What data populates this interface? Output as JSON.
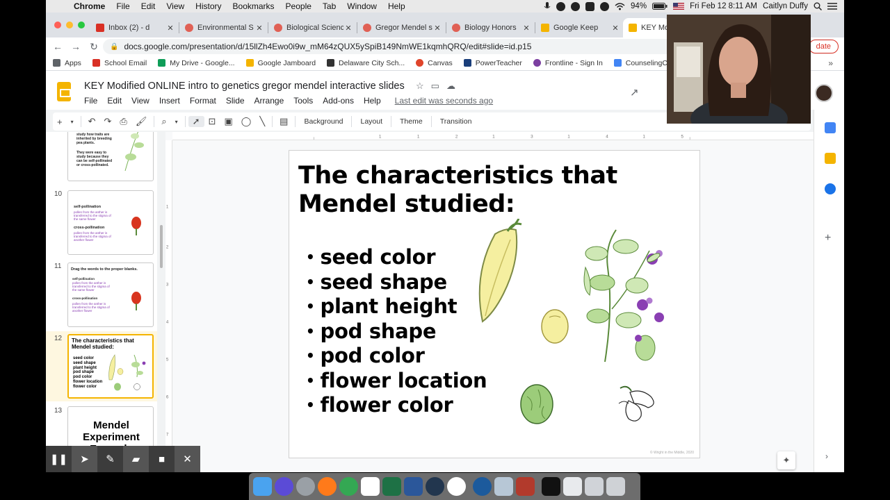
{
  "menubar": {
    "app": "Chrome",
    "items": [
      "File",
      "Edit",
      "View",
      "History",
      "Bookmarks",
      "People",
      "Tab",
      "Window",
      "Help"
    ],
    "battery": "94%",
    "datetime": "Fri Feb 12  8:11 AM",
    "user": "Caitlyn Duffy"
  },
  "tabs": [
    {
      "label": "Inbox (2) - d",
      "color": "#d93025"
    },
    {
      "label": "Environmental S",
      "color": "#e06055"
    },
    {
      "label": "Biological Scienc",
      "color": "#e06055"
    },
    {
      "label": "Gregor Mendel s",
      "color": "#e06055"
    },
    {
      "label": "Biology Honors",
      "color": "#e06055"
    },
    {
      "label": "Google Keep",
      "color": "#f4b400"
    },
    {
      "label": "KEY Mod",
      "color": "#f4b400"
    }
  ],
  "address": {
    "url": "docs.google.com/presentation/d/15llZh4Ewo0i9w_mM64zQUX5ySpiB149NmWE1kqmhQRQ/edit#slide=id.p15",
    "update_label": "date"
  },
  "bookmarks": [
    {
      "label": "Apps",
      "color": "#5f6368"
    },
    {
      "label": "School Email",
      "color": "#d93025"
    },
    {
      "label": "My Drive - Google...",
      "color": "#0f9d58"
    },
    {
      "label": "Google Jamboard",
      "color": "#f4b400"
    },
    {
      "label": "Delaware City Sch...",
      "color": "#333333"
    },
    {
      "label": "Canvas",
      "color": "#e0452b"
    },
    {
      "label": "PowerTeacher",
      "color": "#1a3e7a"
    },
    {
      "label": "Frontline - Sign In",
      "color": "#7b3fa0"
    },
    {
      "label": "CounselingCouns...",
      "color": "#4285f4"
    }
  ],
  "doc": {
    "title": "KEY Modified ONLINE intro to genetics gregor mendel interactive slides",
    "menus": [
      "File",
      "Edit",
      "View",
      "Insert",
      "Format",
      "Slide",
      "Arrange",
      "Tools",
      "Add-ons",
      "Help"
    ],
    "last_edit": "Last edit was seconds ago"
  },
  "toolbar": {
    "background": "Background",
    "layout": "Layout",
    "theme": "Theme",
    "transition": "Transition"
  },
  "filmstrip": {
    "slides": [
      {
        "num": "10",
        "lines": [
          "self-pollination",
          "pollen from the anther is transferred to the stigma of the same flower",
          "cross-pollination",
          "pollen from the anther is transferred to the stigma of another flower"
        ]
      },
      {
        "num": "11",
        "title": "Drag the words to the proper blanks.",
        "lines": [
          "self-pollination",
          "pollen from the anther is transferred to the stigma of the same flower",
          "cross-pollination",
          "pollen from the anther is transferred to the stigma of another flower"
        ]
      },
      {
        "num": "12",
        "title": "The characteristics that Mendel studied:",
        "bullets": [
          "seed color",
          "seed shape",
          "plant height",
          "pod shape",
          "pod color",
          "flower location",
          "flower color"
        ]
      },
      {
        "num": "13",
        "title": "Mendel Experiment Example"
      }
    ],
    "top_partial": [
      "study how traits are inherited by breeding pea plants.",
      "They were easy to study because they can be self-pollinated or cross-pollinated."
    ]
  },
  "slide": {
    "title": "The characteristics that Mendel studied:",
    "bullets": [
      "seed color",
      "seed shape",
      "plant height",
      "pod shape",
      "pod color",
      "flower location",
      "flower color"
    ],
    "credit": "© Wright in the Middle, 2020"
  },
  "colors": {
    "accent": "#f4b400",
    "pea_yellow": "#f5efa0",
    "pea_green": "#9ccc7a",
    "flower_purple": "#8a3fb3"
  },
  "rightrail_icons": [
    "calendar-icon",
    "keep-icon",
    "tasks-icon",
    "plus-icon"
  ]
}
